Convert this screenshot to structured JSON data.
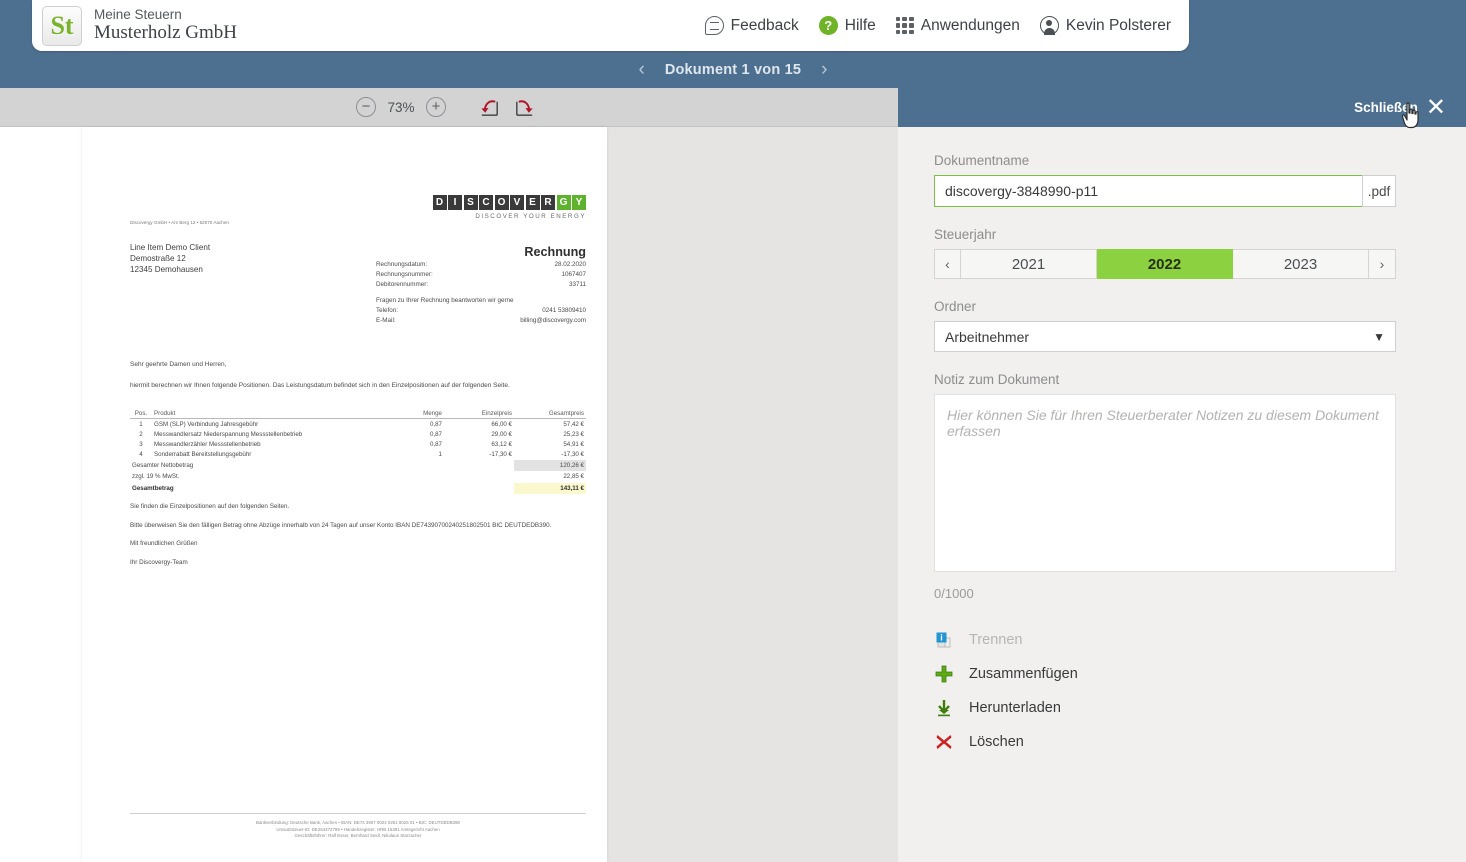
{
  "header": {
    "logo_text": "St",
    "app_name": "Meine Steuern",
    "company": "Musterholz GmbH",
    "feedback_label": "Feedback",
    "help_label": "Hilfe",
    "apps_label": "Anwendungen",
    "user_label": "Kevin Polsterer",
    "icons": {
      "feedback": "speech-bubble-icon",
      "help": "question-mark-icon",
      "apps": "grid-icon",
      "user": "user-circle-icon"
    }
  },
  "doc_nav": {
    "prev": "‹",
    "label": "Dokument 1 von 15",
    "next": "›"
  },
  "viewer_toolbar": {
    "zoom_out": "−",
    "zoom_value": "73%",
    "zoom_in": "+",
    "rotate_left": "rotate-left-icon",
    "rotate_right": "rotate-right-icon"
  },
  "panel_header": {
    "close_label": "Schließen",
    "close_icon": "✕"
  },
  "panel": {
    "name_label": "Dokumentname",
    "name_value": "discovergy-3848990-p11",
    "name_ext": ".pdf",
    "year_label": "Steuerjahr",
    "year_prev": "‹",
    "year_next": "›",
    "years": [
      "2021",
      "2022",
      "2023"
    ],
    "year_selected": "2022",
    "folder_label": "Ordner",
    "folder_value": "Arbeitnehmer",
    "folder_options": [
      "Arbeitnehmer"
    ],
    "note_label": "Notiz zum Dokument",
    "note_value": "",
    "note_placeholder": "Hier können Sie für Ihren Steuerberater Notizen zu diesem Dokument erfassen",
    "note_counter": "0/1000",
    "actions": [
      {
        "label": "Trennen",
        "icon": "split-pages-icon",
        "disabled": true
      },
      {
        "label": "Zusammenfügen",
        "icon": "plus-icon",
        "disabled": false
      },
      {
        "label": "Herunterladen",
        "icon": "download-arrow-icon",
        "disabled": false
      },
      {
        "label": "Löschen",
        "icon": "red-x-icon",
        "disabled": false
      }
    ]
  },
  "document": {
    "logo_letters": [
      "D",
      "I",
      "S",
      "C",
      "O",
      "V",
      "E",
      "R",
      "G",
      "Y"
    ],
    "logo_green_index": 8,
    "logo_tagline": "DISCOVER YOUR ENERGY",
    "sender_line": "Discovergy GmbH • Am Berg 12 • 52070 Aachen",
    "recipient": [
      "Line Item Demo Client",
      "Demostraße 12",
      "12345 Demohausen"
    ],
    "title": "Rechnung",
    "meta": [
      {
        "label": "Rechnungsdatum:",
        "value": "28.02.2020"
      },
      {
        "label": "Rechnungsnummer:",
        "value": "1067407"
      },
      {
        "label": "Debitorennummer:",
        "value": "33711"
      }
    ],
    "help_intro": "Fragen zu Ihrer Rechnung beantworten wir gerne",
    "help_rows": [
      {
        "label": "Telefon:",
        "value": "0241 53809410"
      },
      {
        "label": "E-Mail:",
        "value": "billing@discovergy.com"
      }
    ],
    "salutation": "Sehr geehrte Damen und Herren,",
    "intro": "hiermit berechnen wir Ihnen folgende Positionen. Das Leistungsdatum befindet sich in den Einzelpositionen auf der folgenden Seite.",
    "table": {
      "headers": [
        "Pos.",
        "Produkt",
        "Menge",
        "Einzelpreis",
        "Gesamtpreis"
      ],
      "rows": [
        [
          "1",
          "GSM (SLP) Verbindung Jahresgebühr",
          "0,87",
          "66,00 €",
          "57,42 €"
        ],
        [
          "2",
          "Messwandlersatz Niederspannung Messstellenbetrieb",
          "0,87",
          "29,00 €",
          "25,23 €"
        ],
        [
          "3",
          "Messwandlerzähler Messstellenbetrieb",
          "0,87",
          "63,12 €",
          "54,91 €"
        ],
        [
          "4",
          "Sonderrabatt Bereitstellungsgebühr",
          "1",
          "-17,30 €",
          "-17,30 €"
        ]
      ],
      "net_label": "Gesamter Nettobetrag",
      "net_value": "120,26 €",
      "vat_label": "zzgl. 19 % MwSt.",
      "vat_value": "22,85 €",
      "total_label": "Gesamtbetrag",
      "total_value": "143,11 €"
    },
    "after": [
      "Sie finden die Einzelpositionen auf den folgenden Seiten.",
      "Bitte überweisen Sie den fälligen Betrag ohne Abzüge innerhalb von 24 Tagen auf unser Konto IBAN DE74390700240251802501 BIC DEUTDEDB390.",
      "Mit freundlichen Grüßen",
      "Ihr Discovergy-Team"
    ],
    "footer": [
      "Bankverbindung: Deutsche Bank, Aachen • IBAN: DE74 3907 0024 0251 8025 01 • BIC: DEUTDEDB390",
      "Umsatzsteuer-ID: DE264372799 • Handelsregister: HRB 15391 Amtsgericht Aachen",
      "Geschäftsführer: Ralf Esser, Bernhard Seidl, Nikolaus Starzacher"
    ]
  }
}
